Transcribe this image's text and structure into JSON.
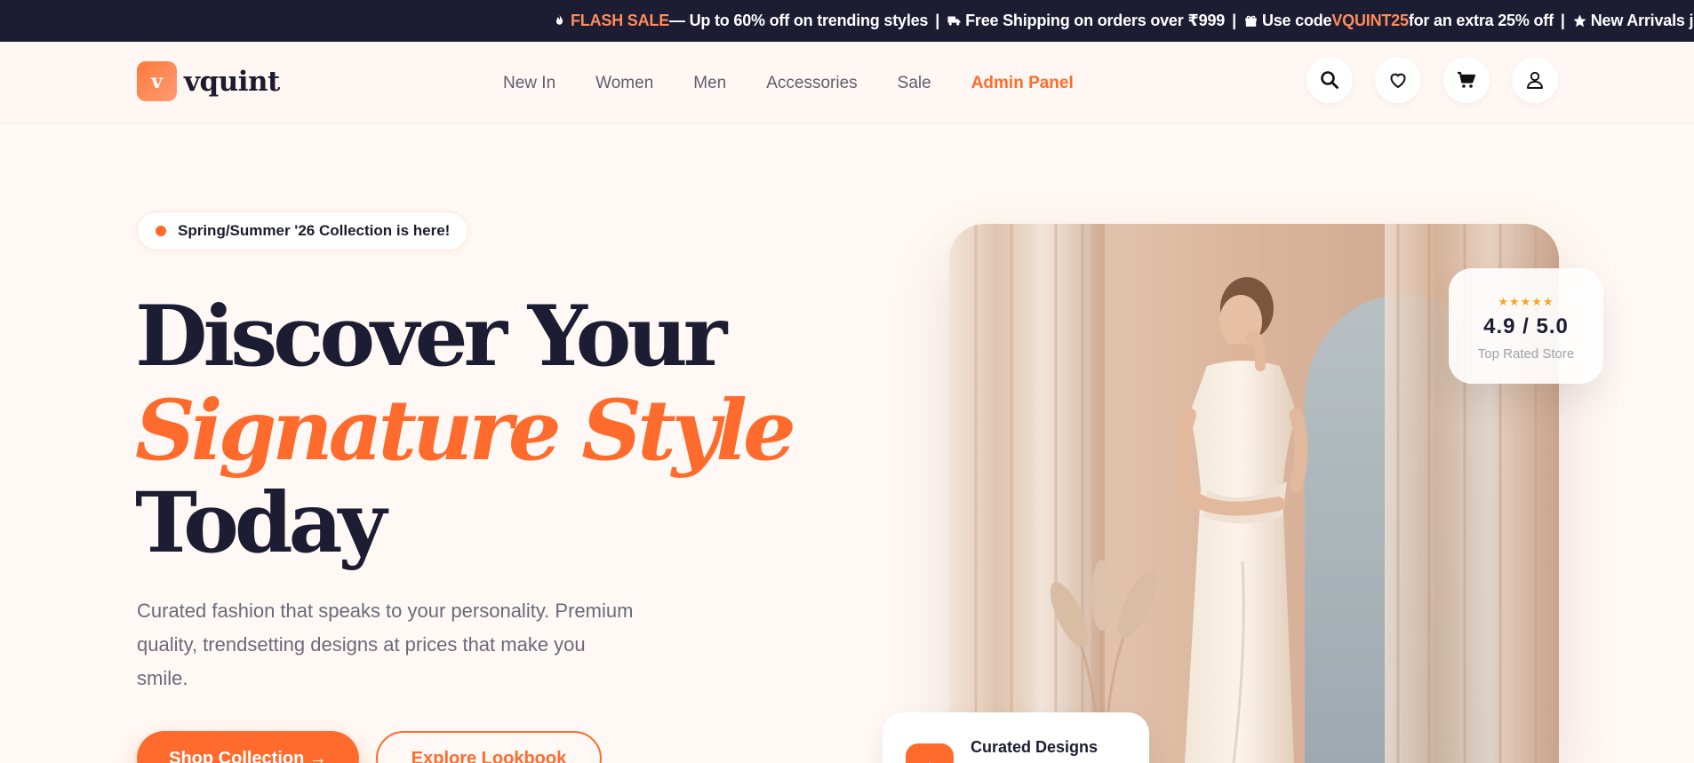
{
  "ticker": {
    "items": [
      {
        "icon": "fire-icon",
        "highlight": "FLASH SALE",
        "text": " — Up to 60% off on trending styles"
      },
      {
        "icon": "truck-icon",
        "highlight": "",
        "text": "Free Shipping on orders over ₹999"
      },
      {
        "icon": "gift-icon",
        "prefix": "Use code ",
        "highlight": "VQUINT25",
        "text": " for an extra 25% off"
      },
      {
        "icon": "star-icon",
        "highlight": "",
        "text": "New Arrivals just dropped"
      }
    ],
    "separator": "|"
  },
  "nav": {
    "logo_letter": "v",
    "logo_text": "vquint",
    "menu": [
      "New In",
      "Women",
      "Men",
      "Accessories",
      "Sale",
      "Admin Panel"
    ],
    "icons": [
      "search-icon",
      "heart-icon",
      "cart-icon",
      "user-icon"
    ]
  },
  "hero": {
    "badge": "Spring/Summer '26 Collection is here!",
    "title_line1": "Discover Your",
    "title_line2": "Signature Style",
    "title_line3": "Today",
    "description": "Curated fashion that speaks to your personality. Premium quality, trendsetting designs at prices that make you smile.",
    "primary_button": "Shop Collection →",
    "secondary_button": "Explore Lookbook"
  },
  "rating_card": {
    "stars": "★★★★★",
    "score": "4.9 / 5.0",
    "label": "Top Rated Store"
  },
  "curated_card": {
    "title": "Curated Designs"
  },
  "colors": {
    "accent": "#ff6b2c",
    "dark": "#1c1d33",
    "background": "#fff8f4"
  }
}
